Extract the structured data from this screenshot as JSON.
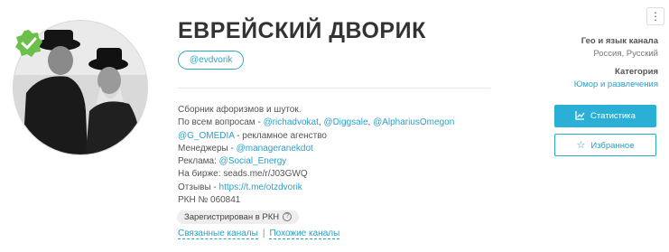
{
  "channel": {
    "title": "ЕВРЕЙСКИЙ ДВОРИК",
    "handle": "@evdvorik"
  },
  "description": {
    "l1": "Сборник афоризмов и шуток.",
    "l2_prefix": "По всем вопросам - ",
    "l2_links": [
      "@richadvokat",
      "@Diggsale",
      "@AlphariusOmegon"
    ],
    "l3_link": "@G_OMEDIA",
    "l3_suffix": " - рекламное агенство",
    "l4_prefix": "Менеджеры - ",
    "l4_link": "@manageranekdot",
    "l5_prefix": "Реклама: ",
    "l5_link": "@Social_Energy",
    "l6": "На бирже: seads.me/r/J03GWQ",
    "l7_prefix": "Отзывы - ",
    "l7_link": "https://t.me/otzdvorik",
    "l8": "РКН № 060841"
  },
  "rkn_badge": {
    "label": "Зарегистрирован в РКН",
    "help": "?"
  },
  "footer_links": {
    "related": "Связанные каналы",
    "sep": "|",
    "similar": "Похожие каналы"
  },
  "sidebar": {
    "menu": "⋮",
    "geo_label": "Гео и язык канала",
    "geo_value": "Россия, Русский",
    "category_label": "Категория",
    "category_value": "Юмор и развлечения",
    "stats_button": "Статистика",
    "fav_button": "Избранное"
  },
  "colors": {
    "accent": "#2ab0d6",
    "verified": "#6cc04a"
  }
}
